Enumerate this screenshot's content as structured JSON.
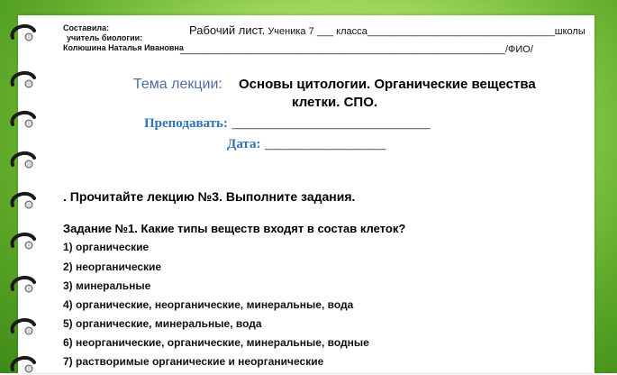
{
  "author": {
    "line1": "Составила:",
    "line2": "учитель биологии:",
    "line3": "Колюшина Наталья Ивановна"
  },
  "header": {
    "worksheet_label": "Рабочий лист.",
    "student_text": "Ученика 7 ___  класса__________________________________школы",
    "fio_text": "___________________________________________________________/ФИО/"
  },
  "lecture": {
    "topic_label": "Тема лекции:",
    "topic_title_line1": "Основы цитологии. Органические вещества",
    "topic_title_line2": "клетки. СПО."
  },
  "fields": {
    "teacher_label": "Преподавать:",
    "teacher_line": "____________________________________",
    "date_label": "Дата:",
    "date_line": "______________________"
  },
  "instruction": ". Прочитайте лекцию №3. Выполните задания.",
  "task1": {
    "question": "Задание №1. Какие типы веществ входят в состав клеток?",
    "options": [
      "1) органические",
      "2) неорганические",
      "3) минеральные",
      "4) органические, неорганические, минеральные, вода",
      "5) органические, минеральные, вода",
      "6) неорганические, органические, минеральные, водные",
      "7) растворимые органические и неорганические"
    ]
  },
  "icons": [
    "spiral-ring-icon"
  ],
  "colors": {
    "accent_green": "#7cc242",
    "topic_blue": "#4a6f9e",
    "label_blue": "#2f74b5"
  }
}
